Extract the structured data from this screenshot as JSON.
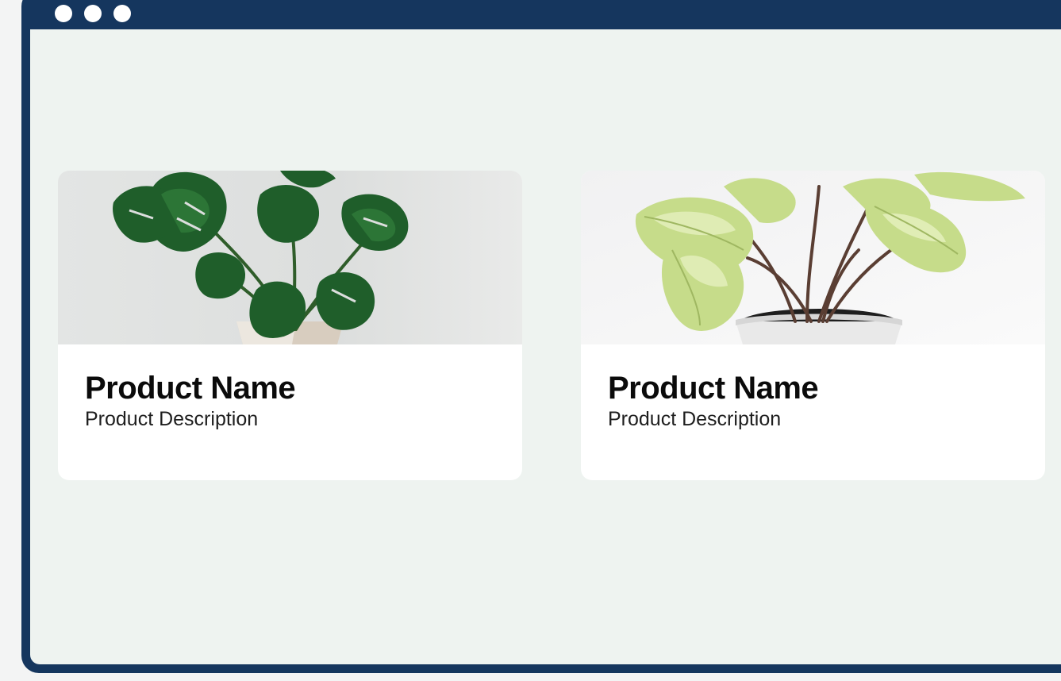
{
  "window": {
    "controls": [
      "dot",
      "dot",
      "dot"
    ]
  },
  "products": [
    {
      "name": "Product Name",
      "description": "Product Description",
      "image_icon": "monstera-plant-image"
    },
    {
      "name": "Product Name",
      "description": "Product Description",
      "image_icon": "syngonium-plant-image"
    }
  ],
  "colors": {
    "frame": "#15365e",
    "page_background": "#eef3f0",
    "card_background": "#ffffff",
    "title_text": "#0b0b0b"
  }
}
